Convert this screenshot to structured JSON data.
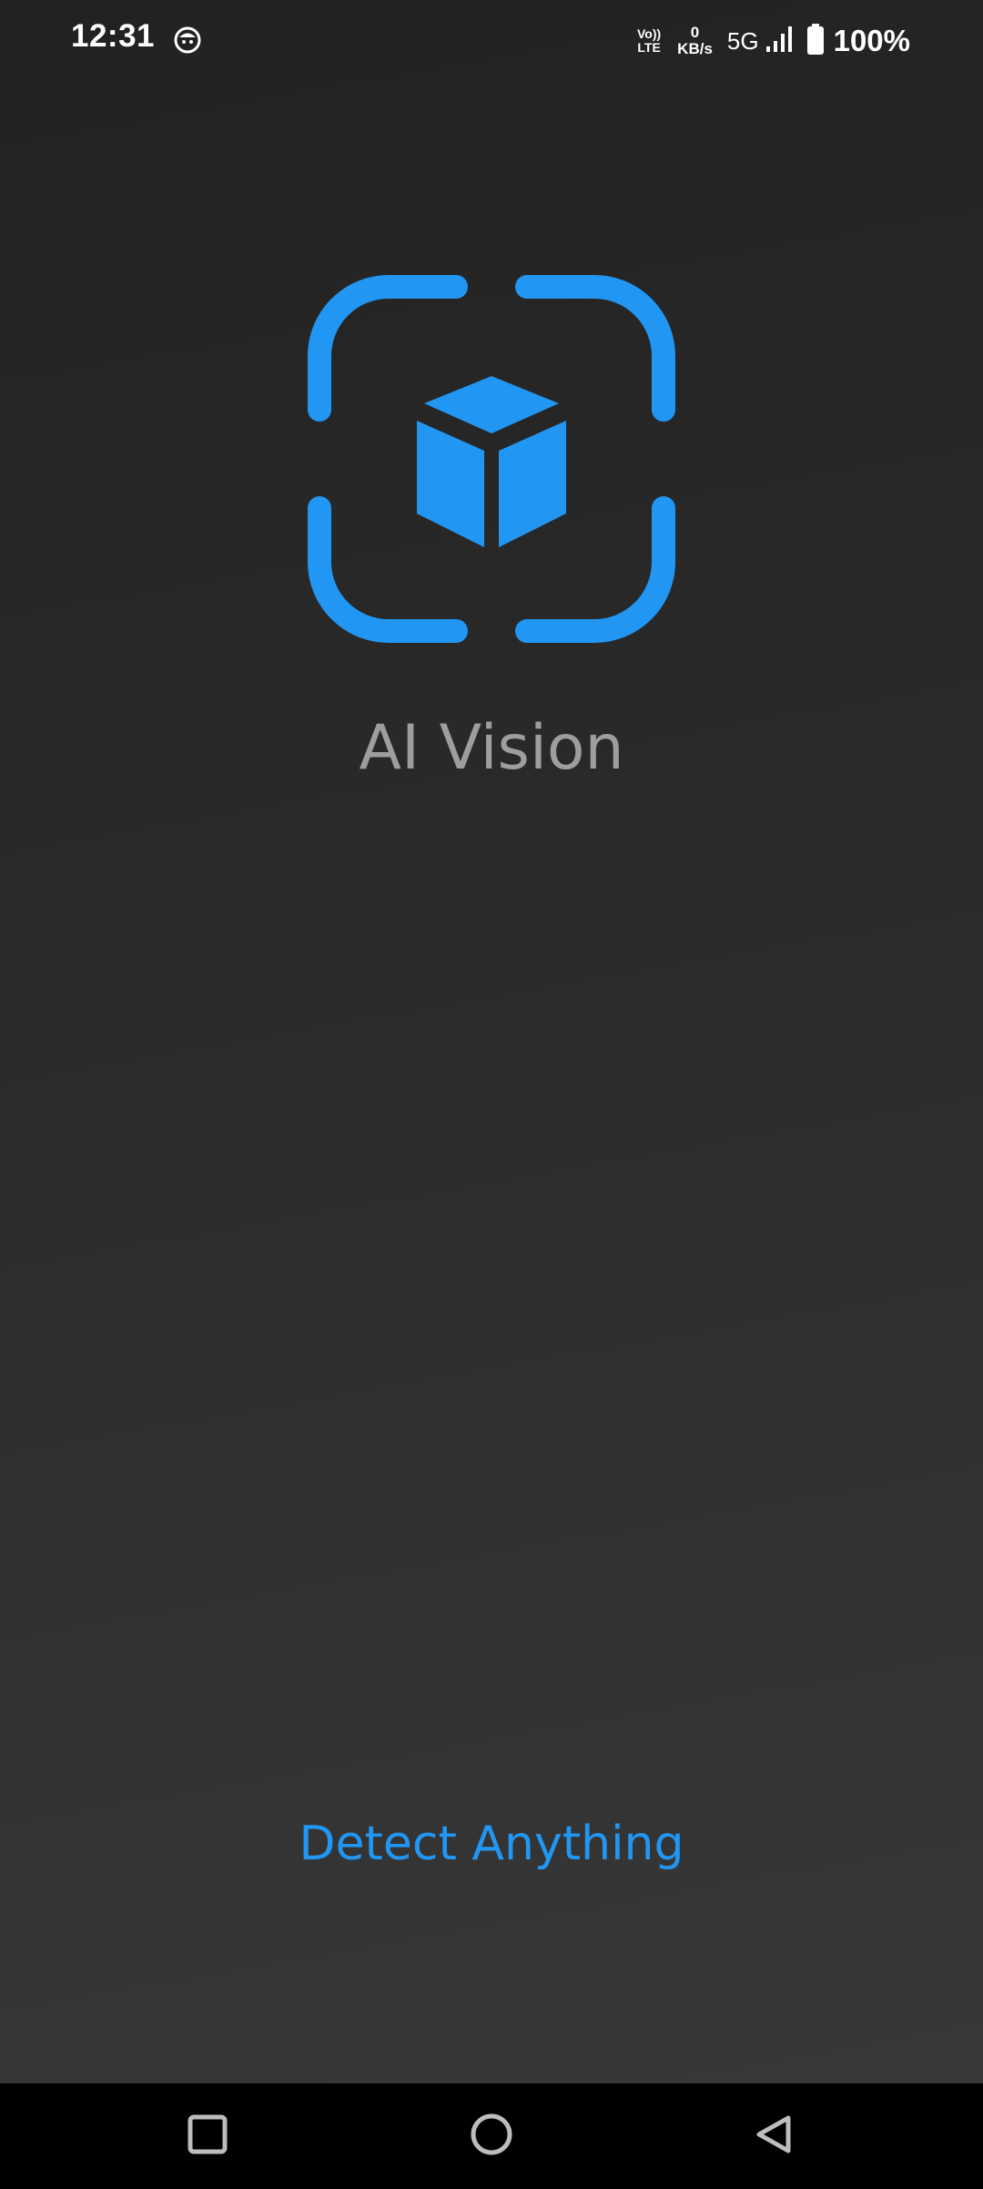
{
  "status_bar": {
    "time": "12:31",
    "notification_icon": "face-icon",
    "volte_top": "Vo))",
    "volte_bottom": "LTE",
    "net_speed_value": "0",
    "net_speed_unit": "KB/s",
    "network_type": "5G",
    "signal_icon": "signal-bars-icon",
    "battery_icon": "battery-icon",
    "battery_percent": "100%"
  },
  "app": {
    "logo_icon": "scan-cube-icon",
    "title": "AI Vision",
    "action_label": "Detect Anything"
  },
  "navigation": {
    "recents_icon": "square-icon",
    "home_icon": "circle-icon",
    "back_icon": "triangle-back-icon"
  },
  "colors": {
    "accent": "#2196f3",
    "title_text": "#9e9e9e",
    "background_top": "#222222",
    "background_bottom": "#393939",
    "nav_bar": "#000000"
  }
}
